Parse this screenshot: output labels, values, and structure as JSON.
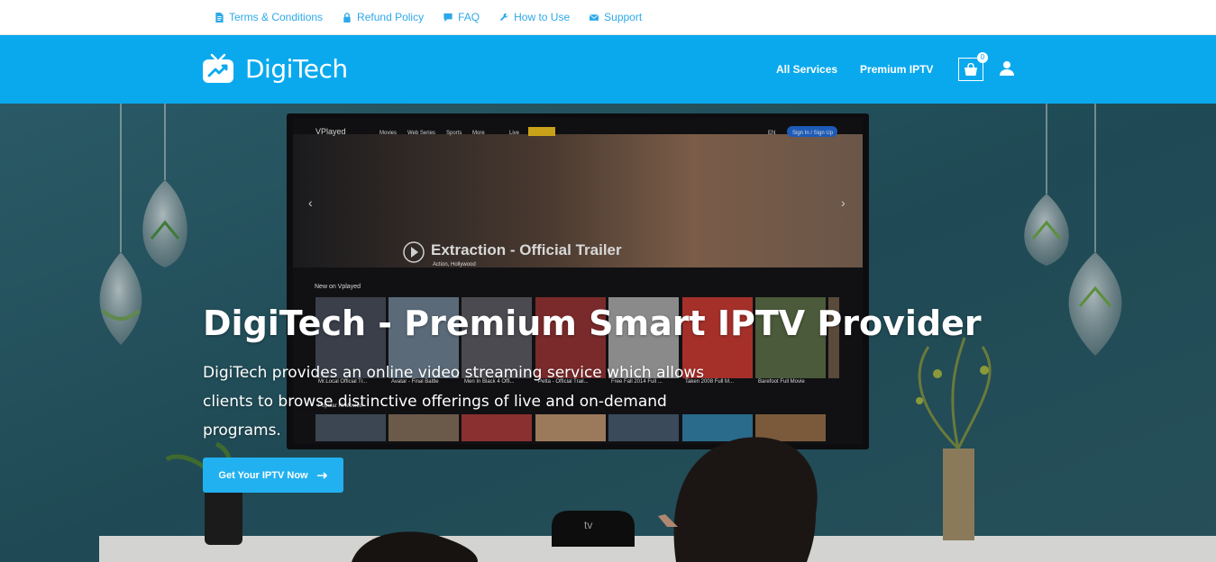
{
  "topbar": {
    "links": [
      {
        "label": "Terms & Conditions",
        "icon": "document-icon"
      },
      {
        "label": "Refund Policy",
        "icon": "lock-icon"
      },
      {
        "label": "FAQ",
        "icon": "chat-icon"
      },
      {
        "label": "How to Use",
        "icon": "wrench-icon"
      },
      {
        "label": "Support",
        "icon": "envelope-icon"
      }
    ]
  },
  "brand": {
    "name": "DigiTech"
  },
  "nav": {
    "links": [
      "All Services",
      "Premium IPTV"
    ],
    "cart_count": "0"
  },
  "hero": {
    "title": "DigiTech - Premium Smart IPTV Provider",
    "description": "DigiTech provides an online video streaming service which allows clients to browse distinctive offerings of live and on-demand programs.",
    "cta_label": "Get Your IPTV Now"
  },
  "tv_screen": {
    "brand": "VPlayed",
    "menu": [
      "Movies",
      "Web Series",
      "Sports",
      "More",
      "Live"
    ],
    "lang": "EN",
    "signin": "Sign In / Sign Up",
    "featured_title": "Extraction - Official Trailer",
    "featured_genre": "Action, Hollywood",
    "row_title": "New on Vplayed",
    "cards": [
      "Mr.Local Official Tr...",
      "Avatar - Final Battle",
      "Men In Black 4 Offi...",
      "Petta - Official Trail...",
      "Free Fall 2014 Full ...",
      "Taken 2008 Full M...",
      "Barefoot Full Movie"
    ],
    "row2_title": "Popular Hi Movies"
  },
  "colors": {
    "accent": "#0aa9ee",
    "cta": "#22b1f0",
    "toplink": "#2da8e8"
  }
}
